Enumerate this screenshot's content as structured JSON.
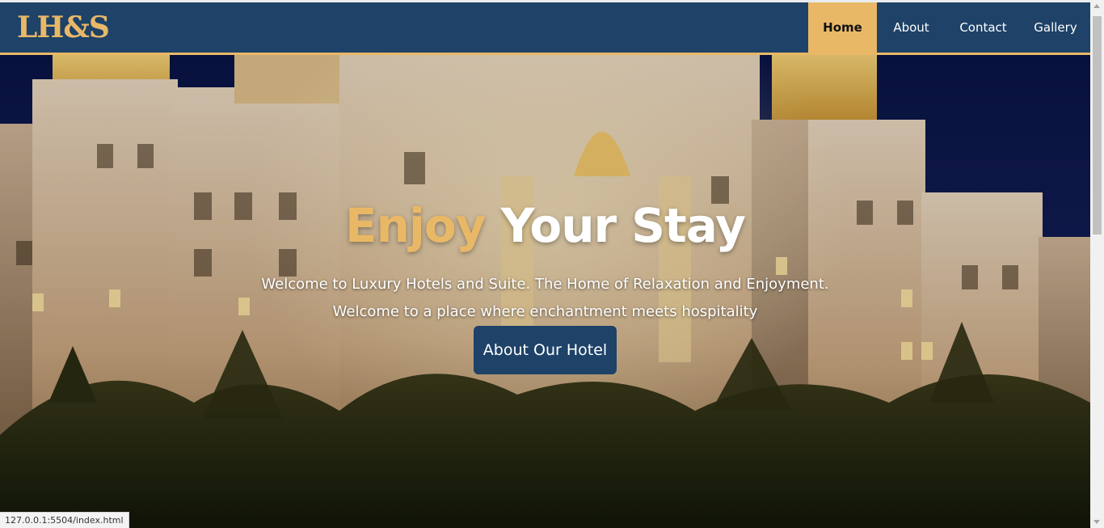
{
  "brand": {
    "logo_text": "LH&S"
  },
  "nav": {
    "items": [
      {
        "label": "Home",
        "active": true
      },
      {
        "label": "About",
        "active": false
      },
      {
        "label": "Contact",
        "active": false
      },
      {
        "label": "Gallery",
        "active": false
      }
    ]
  },
  "hero": {
    "title_accent": "Enjoy",
    "title_rest": " Your Stay",
    "line1": "Welcome to Luxury Hotels and Suite. The Home of Relaxation and Enjoyment.",
    "line2": "Welcome to a place where enchantment meets hospitality",
    "cta_label": "About Our Hotel"
  },
  "status_bar": {
    "url": "127.0.0.1:5504/index.html"
  },
  "colors": {
    "navy": "#1e4268",
    "gold": "#e9b867",
    "white": "#ffffff"
  }
}
